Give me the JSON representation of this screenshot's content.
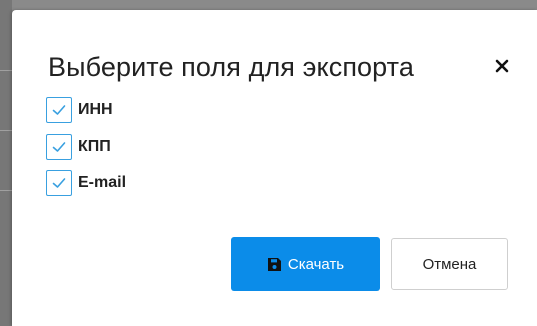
{
  "dialog": {
    "title": "Выберите поля для экспорта",
    "close_icon": "close-icon"
  },
  "fields": [
    {
      "label": "ИНН",
      "checked": true
    },
    {
      "label": "КПП",
      "checked": true
    },
    {
      "label": "E-mail",
      "checked": true
    }
  ],
  "actions": {
    "download_label": "Скачать",
    "download_icon": "save-icon",
    "cancel_label": "Отмена"
  },
  "colors": {
    "accent": "#0b8ce9",
    "checkbox_border": "#39a0e0",
    "backdrop": "#8a8a8a"
  }
}
